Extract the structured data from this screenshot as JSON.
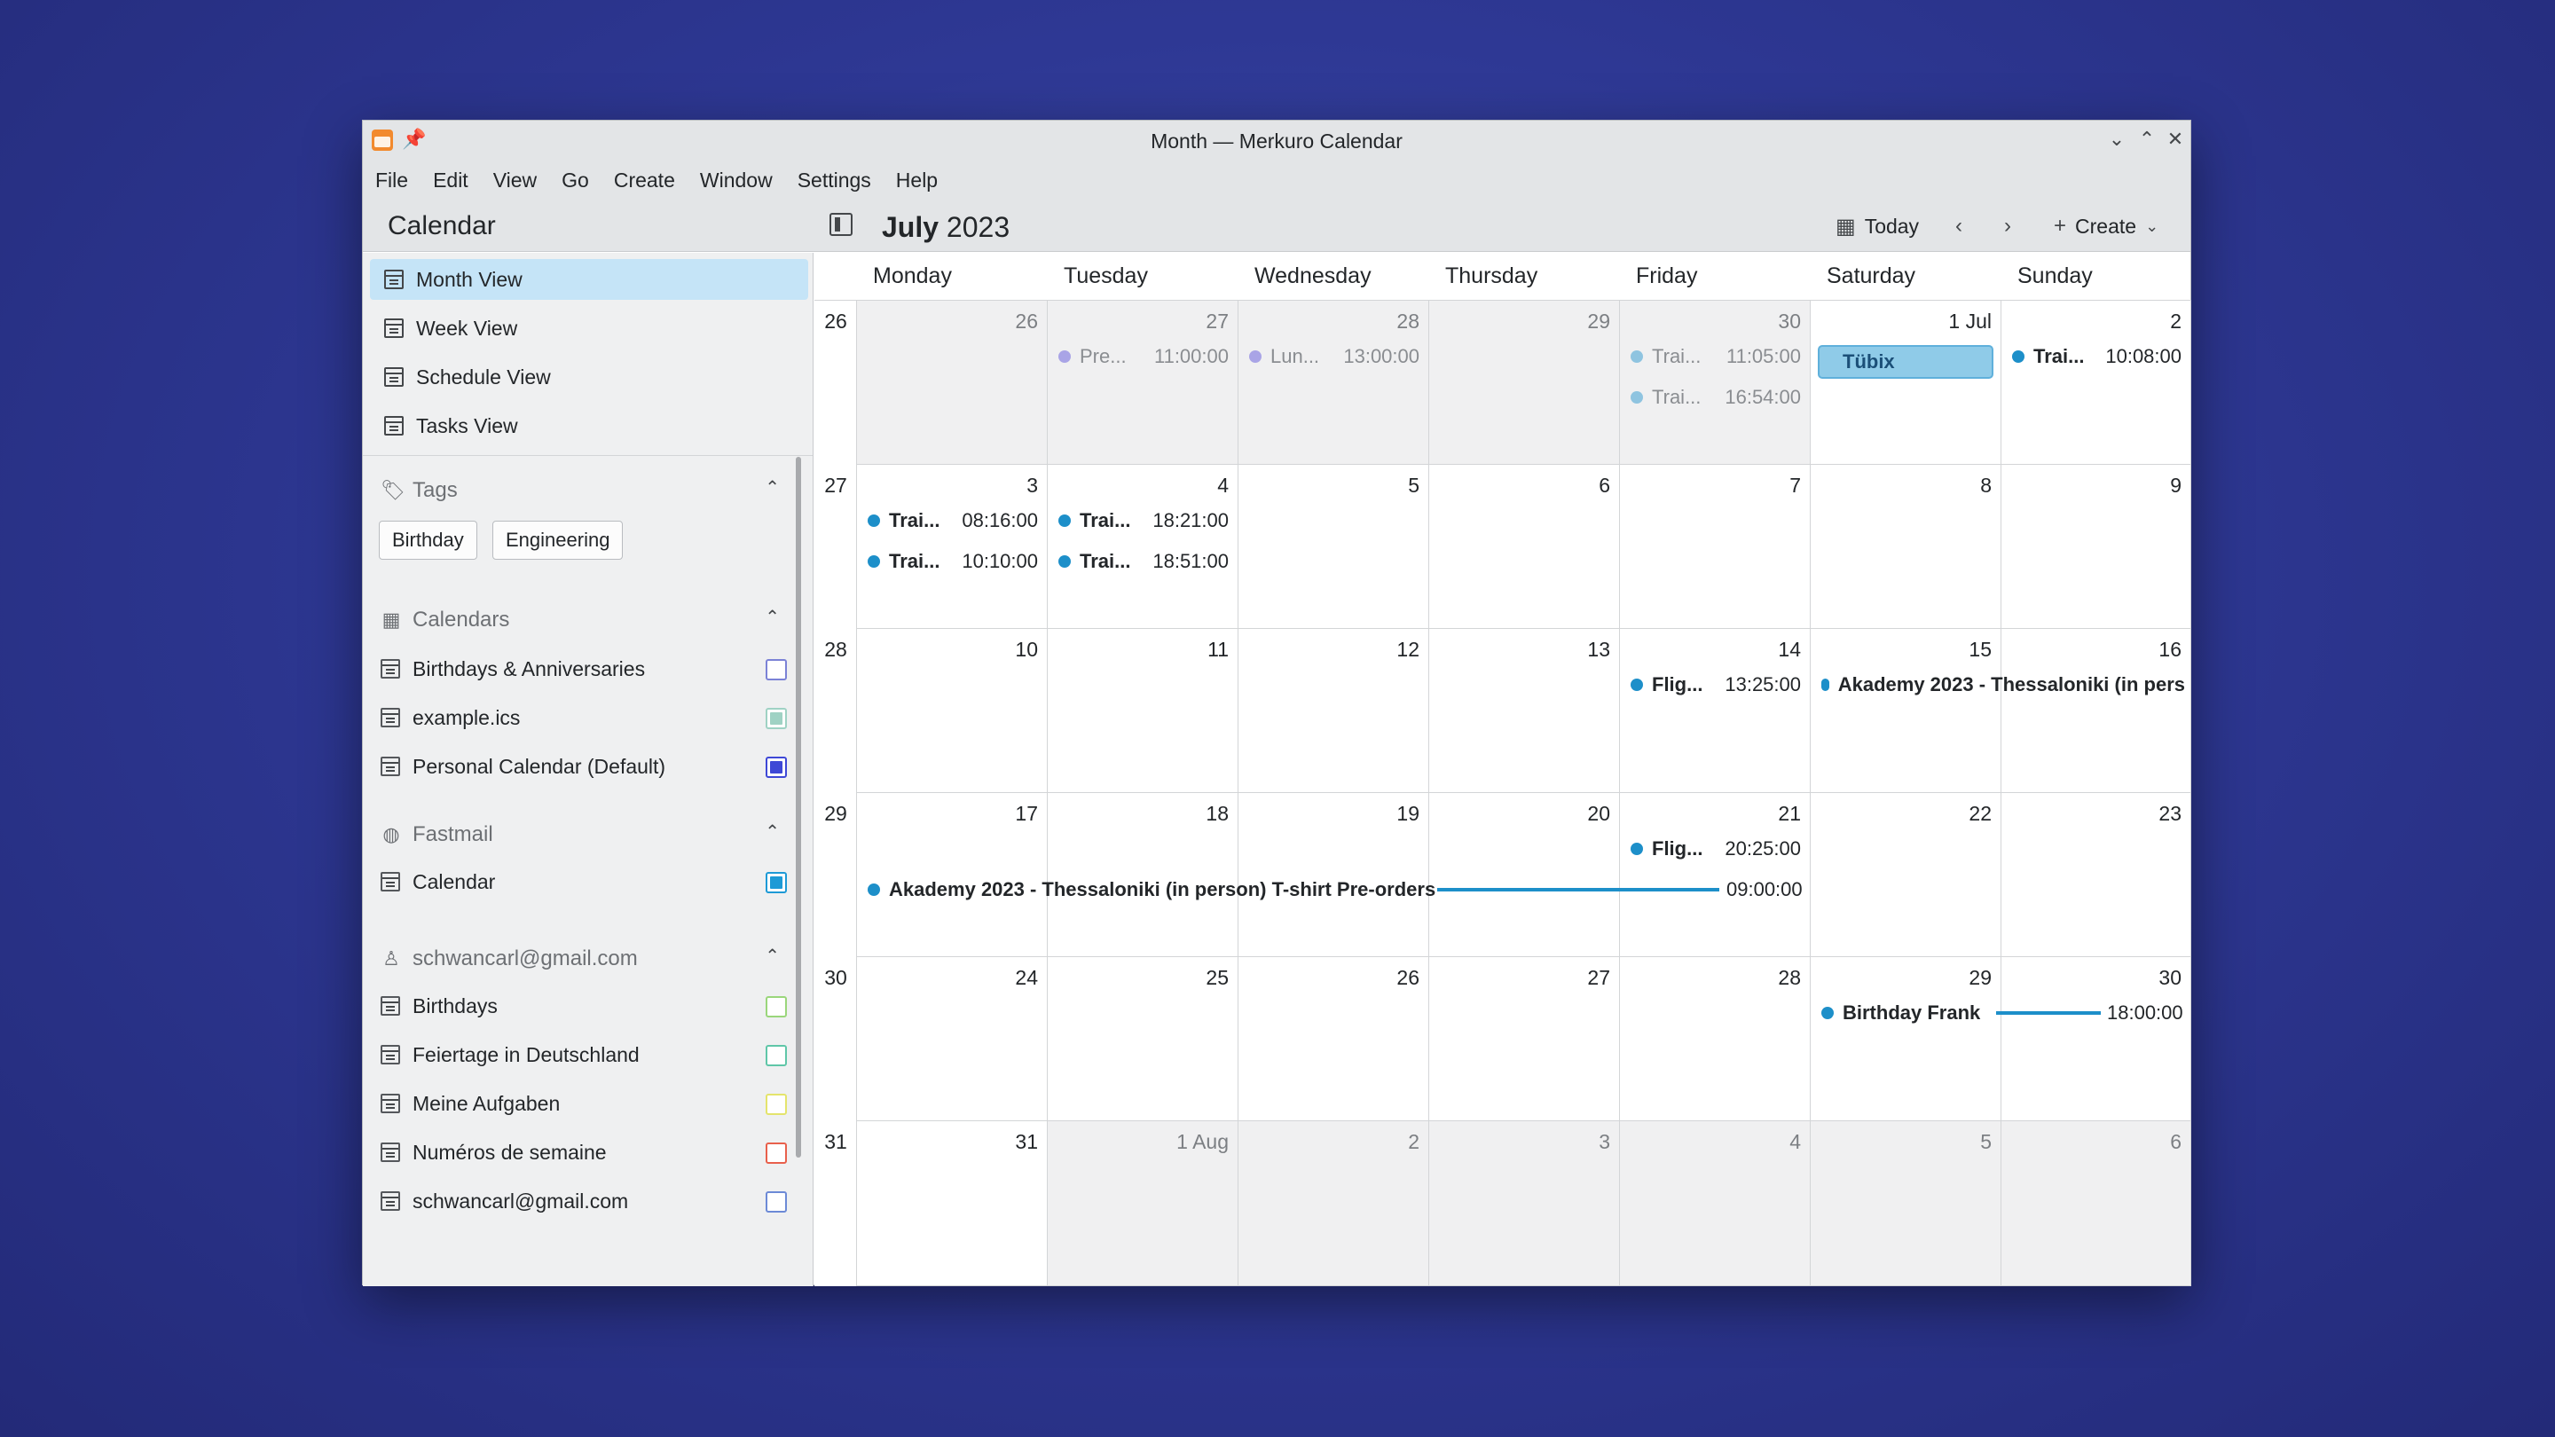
{
  "window": {
    "title": "Month — Merkuro Calendar"
  },
  "menu": [
    "File",
    "Edit",
    "View",
    "Go",
    "Create",
    "Window",
    "Settings",
    "Help"
  ],
  "header": {
    "sidebar_title": "Calendar",
    "month": "July",
    "year": "2023",
    "today_label": "Today",
    "create_label": "Create"
  },
  "views": [
    {
      "label": "Month View",
      "active": true
    },
    {
      "label": "Week View",
      "active": false
    },
    {
      "label": "Schedule View",
      "active": false
    },
    {
      "label": "Tasks View",
      "active": false
    }
  ],
  "tags": {
    "title": "Tags",
    "items": [
      "Birthday",
      "Engineering"
    ]
  },
  "calendars": {
    "title": "Calendars",
    "items": [
      {
        "label": "Birthdays & Anniversaries",
        "color": "#7b82d6",
        "checked": false
      },
      {
        "label": "example.ics",
        "color": "#9fd2c4",
        "checked": true
      },
      {
        "label": "Personal Calendar (Default)",
        "color": "#3e48d6",
        "checked": true
      }
    ]
  },
  "fastmail": {
    "title": "Fastmail",
    "items": [
      {
        "label": "Calendar",
        "color": "#1d9ad6",
        "checked": true
      }
    ]
  },
  "gmail": {
    "title": "schwancarl@gmail.com",
    "items": [
      {
        "label": "Birthdays",
        "color": "#9ad67b",
        "checked": false
      },
      {
        "label": "Feiertage in Deutschland",
        "color": "#5fc6a8",
        "checked": false
      },
      {
        "label": "Meine Aufgaben",
        "color": "#e4e46c",
        "checked": false
      },
      {
        "label": "Numéros de semaine",
        "color": "#e8604c",
        "checked": false
      },
      {
        "label": "schwancarl@gmail.com",
        "color": "#6c8ad6",
        "checked": false
      }
    ]
  },
  "weekdays": [
    "Monday",
    "Tuesday",
    "Wednesday",
    "Thursday",
    "Friday",
    "Saturday",
    "Sunday"
  ],
  "weeknums": [
    "26",
    "27",
    "28",
    "29",
    "30",
    "31"
  ],
  "days": [
    [
      "26",
      "27",
      "28",
      "29",
      "30",
      "1 Jul",
      "2"
    ],
    [
      "3",
      "4",
      "5",
      "6",
      "7",
      "8",
      "9"
    ],
    [
      "10",
      "11",
      "12",
      "13",
      "14",
      "15",
      "16"
    ],
    [
      "17",
      "18",
      "19",
      "20",
      "21",
      "22",
      "23"
    ],
    [
      "24",
      "25",
      "26",
      "27",
      "28",
      "29",
      "30"
    ],
    [
      "31",
      "1 Aug",
      "2",
      "3",
      "4",
      "5",
      "6"
    ]
  ],
  "events": {
    "tue_27": {
      "title": "Pre...",
      "time": "11:00:00",
      "color": "#a9a4e6"
    },
    "wed_28": {
      "title": "Lun...",
      "time": "13:00:00",
      "color": "#a9a4e6"
    },
    "fri_30_a": {
      "title": "Trai...",
      "time": "11:05:00",
      "color": "#8fc4e0"
    },
    "fri_30_b": {
      "title": "Trai...",
      "time": "16:54:00",
      "color": "#8fc4e0"
    },
    "sat_1": {
      "title": "Tübix"
    },
    "sun_2": {
      "title": "Trai...",
      "time": "10:08:00",
      "color": "#1d8fc9"
    },
    "mon_3_a": {
      "title": "Trai...",
      "time": "08:16:00",
      "color": "#1d8fc9"
    },
    "mon_3_b": {
      "title": "Trai...",
      "time": "10:10:00",
      "color": "#1d8fc9"
    },
    "tue_4_a": {
      "title": "Trai...",
      "time": "18:21:00",
      "color": "#1d8fc9"
    },
    "tue_4_b": {
      "title": "Trai...",
      "time": "18:51:00",
      "color": "#1d8fc9"
    },
    "fri_14": {
      "title": "Flig...",
      "time": "13:25:00",
      "color": "#1d8fc9"
    },
    "sat_15": {
      "title": "Akademy 2023 - Thessaloniki (in pers",
      "color": "#1d8fc9"
    },
    "fri_21": {
      "title": "Flig...",
      "time": "20:25:00",
      "color": "#1d8fc9"
    },
    "week29_span": {
      "title": "Akademy 2023 - Thessaloniki (in person) T-shirt Pre-orders",
      "time": "09:00:00",
      "color": "#1d8fc9"
    },
    "week30_span": {
      "title": "Birthday Frank",
      "time": "18:00:00",
      "color": "#1d8fc9"
    }
  }
}
